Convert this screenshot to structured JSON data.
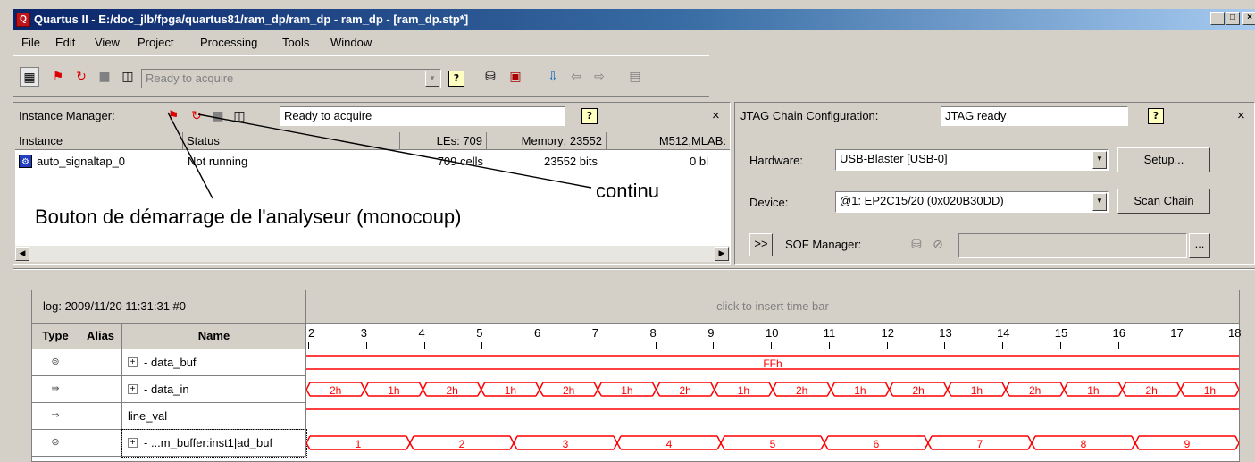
{
  "window": {
    "title": "Quartus II - E:/doc_jlb/fpga/quartus81/ram_dp/ram_dp - ram_dp - [ram_dp.stp*]",
    "app_icon": "quartus-icon",
    "controls": [
      "_",
      "□",
      "×"
    ]
  },
  "menu": [
    "File",
    "Edit",
    "View",
    "Project",
    "Processing",
    "Tools",
    "Window"
  ],
  "toolbar": {
    "status": "Ready to acquire",
    "help": "?"
  },
  "instance_manager": {
    "label": "Instance Manager:",
    "status": "Ready to acquire",
    "help": "?",
    "close": "×",
    "columns": [
      "Instance",
      "Status",
      "LEs: 709",
      "Memory: 23552",
      "M512,MLAB:"
    ],
    "rows": [
      {
        "instance": "auto_signaltap_0",
        "status": "Not running",
        "les": "709 cells",
        "memory": "23552 bits",
        "m512": "0 bl"
      }
    ]
  },
  "annotations": {
    "continu": "continu",
    "start_button": "Bouton de démarrage de l'analyseur (monocoup)"
  },
  "jtag": {
    "label": "JTAG Chain Configuration:",
    "status": "JTAG ready",
    "help": "?",
    "close": "×",
    "hardware_label": "Hardware:",
    "hardware_value": "USB-Blaster [USB-0]",
    "setup_button": "Setup...",
    "device_label": "Device:",
    "device_value": "@1: EP2C15/20 (0x020B30DD)",
    "scan_button": "Scan Chain",
    "expand_button": ">>",
    "sof_label": "SOF Manager:",
    "browse_button": "..."
  },
  "waveform": {
    "log": "log: 2009/11/20 11:31:31  #0",
    "insert_hint": "click to insert time bar",
    "columns": {
      "type": "Type",
      "alias": "Alias",
      "name": "Name"
    },
    "ticks": [
      "2",
      "3",
      "4",
      "5",
      "6",
      "7",
      "8",
      "9",
      "10",
      "11",
      "12",
      "13",
      "14",
      "15",
      "16",
      "17",
      "18"
    ],
    "rows": [
      {
        "icon": "bus-icon",
        "expand": "+",
        "name": "data_buf",
        "kind": "const",
        "value": "FFh"
      },
      {
        "icon": "input-bus-icon",
        "expand": "+",
        "name": "data_in",
        "kind": "bus",
        "values": [
          "2h",
          "1h",
          "2h",
          "1h",
          "2h",
          "1h",
          "2h",
          "1h",
          "2h",
          "1h",
          "2h",
          "1h",
          "2h",
          "1h",
          "2h",
          "1h"
        ]
      },
      {
        "icon": "input-icon",
        "expand": "",
        "name": "line_val",
        "kind": "high"
      },
      {
        "icon": "bus-icon",
        "expand": "+",
        "name": "...m_buffer:inst1|ad_buf",
        "kind": "bus",
        "values": [
          "1",
          "2",
          "3",
          "4",
          "5",
          "6",
          "7",
          "8",
          "9"
        ]
      }
    ]
  },
  "colors": {
    "wave": "#ff0000",
    "title_left": "#0a246a",
    "title_right": "#a6caf0",
    "face": "#d4d0c8"
  }
}
